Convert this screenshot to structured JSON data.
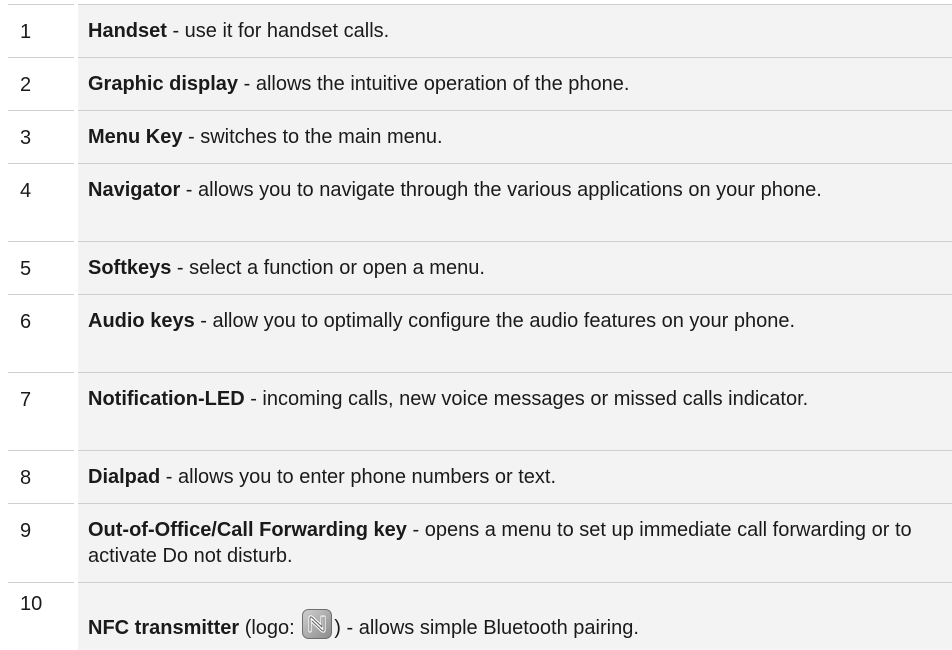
{
  "rows": [
    {
      "num": "1",
      "term": "Handset",
      "text": " - use it for handset calls."
    },
    {
      "num": "2",
      "term": "Graphic display",
      "text": " - allows the intuitive operation of the phone."
    },
    {
      "num": "3",
      "term": "Menu Key",
      "text": " - switches to the main menu."
    },
    {
      "num": "4",
      "term": "Navigator",
      "text": " - allows you to navigate through the various applications on your phone."
    },
    {
      "num": "5",
      "term": "Softkeys",
      "text": " - select a function or open a menu."
    },
    {
      "num": "6",
      "term": "Audio keys",
      "text": " - allow you to optimally configure the audio features on your phone."
    },
    {
      "num": "7",
      "term": "Notification-LED",
      "text": " - incoming calls, new voice messages or missed calls indicator."
    },
    {
      "num": "8",
      "term": "Dialpad",
      "text": " - allows you to enter phone numbers or text."
    },
    {
      "num": "9",
      "term": "Out-of-Office/Call Forwarding key",
      "text": " - opens a menu to set up immediate call forwarding or to activate Do not disturb."
    },
    {
      "num": "10",
      "term": "NFC transmitter",
      "text_before_logo": " (logo: ",
      "logo_icon": "nfc-logo-icon",
      "text_after_logo": ") - allows simple Bluetooth pairing."
    }
  ]
}
